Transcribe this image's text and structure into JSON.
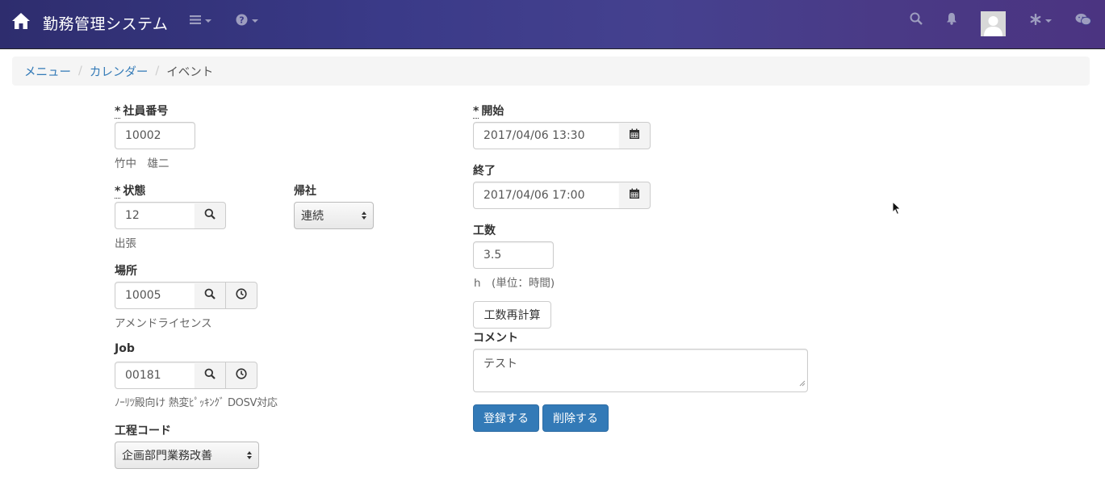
{
  "app": {
    "title": "勤務管理システム"
  },
  "colors": {
    "navbar_start": "#2e2d6e",
    "navbar_end": "#4b3481",
    "primary": "#337ab7",
    "link": "#337ab7"
  },
  "navbar": {
    "icons": [
      "home-icon",
      "bars-icon",
      "question-circle-icon",
      "search-icon",
      "bell-icon",
      "avatar",
      "asterisk-icon",
      "wechat-icon"
    ]
  },
  "breadcrumb": {
    "items": [
      "メニュー",
      "カレンダー",
      "イベント"
    ]
  },
  "form": {
    "employee_no": {
      "label": "社員番号",
      "required_mark": "*",
      "value": "10002",
      "helper": "竹中　雄二"
    },
    "status": {
      "label": "状態",
      "required_mark": "*",
      "value": "12",
      "helper": "出張"
    },
    "return_to_office": {
      "label": "帰社",
      "selected": "連続"
    },
    "location": {
      "label": "場所",
      "value": "10005",
      "helper": "アメンドライセンス"
    },
    "job": {
      "label": "Job",
      "value": "00181",
      "helper": "ﾉｰﾘﾂ殿向け 熱変ﾋﾟｯｷﾝｸﾞ DOSV対応"
    },
    "process_code": {
      "label": "工程コード",
      "selected": "企画部門業務改善"
    },
    "start": {
      "label": "開始",
      "required_mark": "*",
      "value": "2017/04/06 13:30"
    },
    "end": {
      "label": "終了",
      "value": "2017/04/06 17:00"
    },
    "man_hours": {
      "label": "工数",
      "value": "3.5",
      "helper": "h　(単位：時間)"
    },
    "recalc_button": "工数再計算",
    "comment": {
      "label": "コメント",
      "value": "テスト"
    },
    "register_button": "登録する",
    "delete_button": "削除する"
  }
}
